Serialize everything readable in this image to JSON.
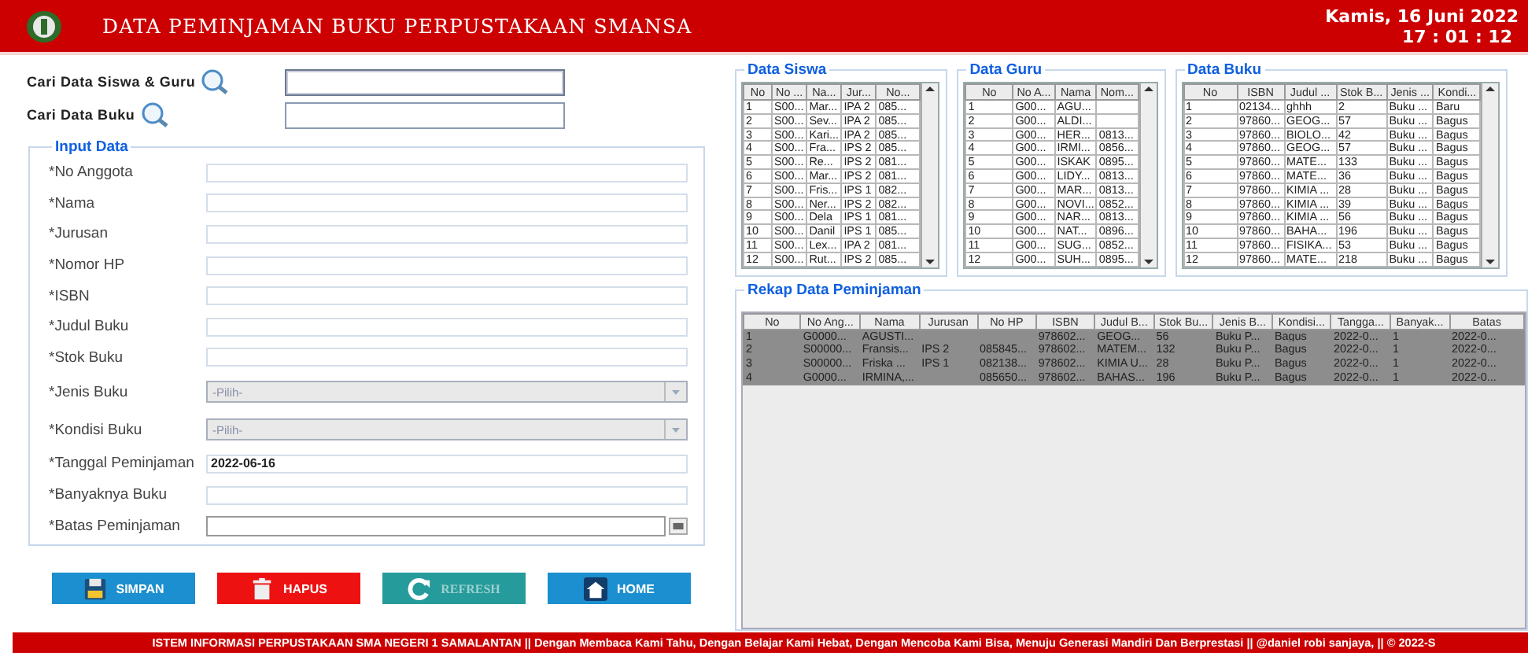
{
  "header": {
    "title": "DATA PEMINJAMAN BUKU PERPUSTAKAAN SMANSA",
    "date": "Kamis, 16 Juni 2022",
    "time": "17 : 01 : 12"
  },
  "search": [
    {
      "label": "Cari Data Siswa & Guru",
      "focused": true
    },
    {
      "label": "Cari Data Buku",
      "focused": false
    }
  ],
  "input_data": {
    "title": "Input Data",
    "fields": [
      {
        "label": "*No Anggota",
        "kind": "text"
      },
      {
        "label": "*Nama",
        "kind": "text"
      },
      {
        "label": "*Jurusan",
        "kind": "text"
      },
      {
        "label": "*Nomor HP",
        "kind": "text"
      },
      {
        "label": "*ISBN",
        "kind": "text"
      },
      {
        "label": "*Judul Buku",
        "kind": "text"
      },
      {
        "label": "*Stok Buku",
        "kind": "text"
      },
      {
        "label": "*Jenis Buku",
        "kind": "select",
        "placeholder": "-Pilih-"
      },
      {
        "label": "*Kondisi Buku",
        "kind": "select",
        "placeholder": "-Pilih-"
      },
      {
        "label": "*Tanggal Peminjaman",
        "kind": "text",
        "value": "2022-06-16"
      },
      {
        "label": "*Banyaknya Buku",
        "kind": "text"
      },
      {
        "label": "*Batas Peminjaman",
        "kind": "date"
      }
    ]
  },
  "buttons": [
    {
      "label": "SIMPAN",
      "kind": "save",
      "disabled": false
    },
    {
      "label": "HAPUS",
      "kind": "delete",
      "disabled": false
    },
    {
      "label": "REFRESH",
      "kind": "refresh",
      "disabled": true
    },
    {
      "label": "HOME",
      "kind": "home",
      "disabled": false
    }
  ],
  "tables": [
    {
      "title": "Data Siswa",
      "columns": [
        "No",
        "No ...",
        "Na...",
        "Jur...",
        "No..."
      ],
      "rows": [
        [
          "1",
          "S00...",
          "Mar...",
          "IPA 2",
          "085..."
        ],
        [
          "2",
          "S00...",
          "Sev...",
          "IPA 2",
          "085..."
        ],
        [
          "3",
          "S00...",
          "Kari...",
          "IPA 2",
          "085..."
        ],
        [
          "4",
          "S00...",
          "Fra...",
          "IPS 2",
          "085..."
        ],
        [
          "5",
          "S00...",
          "Re...",
          "IPS 2",
          "081..."
        ],
        [
          "6",
          "S00...",
          "Mar...",
          "IPS 2",
          "081..."
        ],
        [
          "7",
          "S00...",
          "Fris...",
          "IPS 1",
          "082..."
        ],
        [
          "8",
          "S00...",
          "Ner...",
          "IPS 2",
          "082..."
        ],
        [
          "9",
          "S00...",
          "Dela",
          "IPS 1",
          "081..."
        ],
        [
          "10",
          "S00...",
          "Danil",
          "IPS 1",
          "085..."
        ],
        [
          "11",
          "S00...",
          "Lex...",
          "IPA 2",
          "081..."
        ],
        [
          "12",
          "S00...",
          "Rut...",
          "IPS 2",
          "085..."
        ]
      ]
    },
    {
      "title": "Data Guru",
      "columns": [
        "No",
        "No A...",
        "Nama",
        "Nom..."
      ],
      "rows": [
        [
          "1",
          "G00...",
          "AGU...",
          null
        ],
        [
          "2",
          "G00...",
          "ALDI...",
          null
        ],
        [
          "3",
          "G00...",
          "HER...",
          "0813..."
        ],
        [
          "4",
          "G00...",
          "IRMI...",
          "0856..."
        ],
        [
          "5",
          "G00...",
          "ISKAK",
          "0895..."
        ],
        [
          "6",
          "G00...",
          "LIDY...",
          "0813..."
        ],
        [
          "7",
          "G00...",
          "MAR...",
          "0813..."
        ],
        [
          "8",
          "G00...",
          "NOVI...",
          "0852..."
        ],
        [
          "9",
          "G00...",
          "NAR...",
          "0813..."
        ],
        [
          "10",
          "G00...",
          "NAT...",
          "0896..."
        ],
        [
          "11",
          "G00...",
          "SUG...",
          "0852..."
        ],
        [
          "12",
          "G00...",
          "SUH...",
          "0895..."
        ]
      ]
    },
    {
      "title": "Data Buku",
      "columns": [
        "No",
        "ISBN",
        "Judul ...",
        "Stok B...",
        "Jenis ...",
        "Kondi..."
      ],
      "rows": [
        [
          "1",
          "02134...",
          "ghhh",
          "2",
          "Buku ...",
          "Baru"
        ],
        [
          "2",
          "97860...",
          "GEOG...",
          "57",
          "Buku ...",
          "Bagus"
        ],
        [
          "3",
          "97860...",
          "BIOLO...",
          "42",
          "Buku ...",
          "Bagus"
        ],
        [
          "4",
          "97860...",
          "GEOG...",
          "57",
          "Buku ...",
          "Bagus"
        ],
        [
          "5",
          "97860...",
          "MATE...",
          "133",
          "Buku ...",
          "Bagus"
        ],
        [
          "6",
          "97860...",
          "MATE...",
          "36",
          "Buku ...",
          "Bagus"
        ],
        [
          "7",
          "97860...",
          "KIMIA ...",
          "28",
          "Buku ...",
          "Bagus"
        ],
        [
          "8",
          "97860...",
          "KIMIA ...",
          "39",
          "Buku ...",
          "Bagus"
        ],
        [
          "9",
          "97860...",
          "KIMIA ...",
          "56",
          "Buku ...",
          "Bagus"
        ],
        [
          "10",
          "97860...",
          "BAHA...",
          "196",
          "Buku ...",
          "Bagus"
        ],
        [
          "11",
          "97860...",
          "FISIKA...",
          "53",
          "Buku ...",
          "Bagus"
        ],
        [
          "12",
          "97860...",
          "MATE...",
          "218",
          "Buku ...",
          "Bagus"
        ]
      ]
    }
  ],
  "rekap": {
    "title": "Rekap Data Peminjaman",
    "columns": [
      "No",
      "No Ang...",
      "Nama",
      "Jurusan",
      "No HP",
      "ISBN",
      "Judul B...",
      "Stok Bu...",
      "Jenis B...",
      "Kondisi...",
      "Tangga...",
      "Banyak...",
      "Batas"
    ],
    "rows": [
      {
        "selected": true,
        "cells": [
          "1",
          "G0000...",
          "AGUSTI...",
          null,
          null,
          "978602...",
          "GEOG...",
          "56",
          "Buku P...",
          "Bagus",
          "2022-0...",
          "1",
          "2022-0..."
        ]
      },
      {
        "selected": true,
        "cells": [
          "2",
          "S00000...",
          "Fransis...",
          "IPS 2",
          "085845...",
          "978602...",
          "MATEM...",
          "132",
          "Buku P...",
          "Bagus",
          "2022-0...",
          "1",
          "2022-0..."
        ]
      },
      {
        "selected": true,
        "cells": [
          "3",
          "S00000...",
          "Friska ...",
          "IPS 1",
          "082138...",
          "978602...",
          "KIMIA U...",
          "28",
          "Buku P...",
          "Bagus",
          "2022-0...",
          "1",
          "2022-0..."
        ]
      },
      {
        "selected": true,
        "cells": [
          "4",
          "G0000...",
          "IRMINA,...",
          null,
          "085650...",
          "978602...",
          "BAHAS...",
          "196",
          "Buku P...",
          "Bagus",
          "2022-0...",
          "1",
          "2022-0..."
        ]
      }
    ]
  },
  "footer": "ISTEM INFORMASI PERPUSTAKAAN SMA NEGERI 1 SAMALANTAN || Dengan Membaca Kami Tahu, Dengan Belajar Kami Hebat, Dengan Mencoba Kami Bisa, Menuju Generasi Mandiri Dan Berprestasi || @daniel robi sanjaya, || © 2022-S"
}
